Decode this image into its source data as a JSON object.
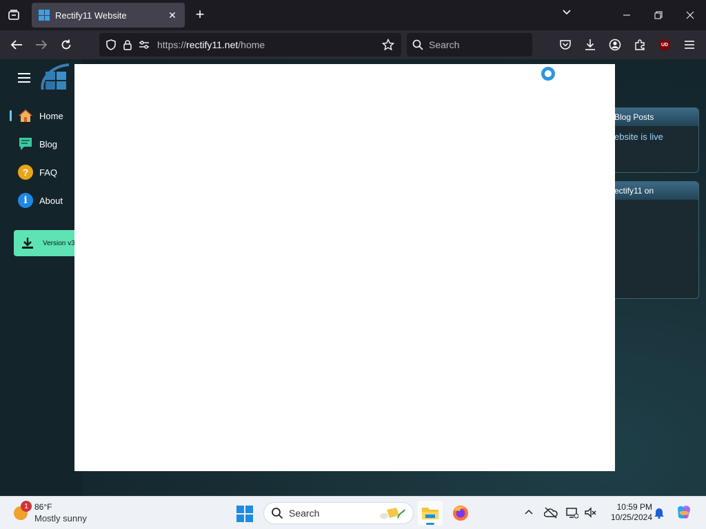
{
  "browser": {
    "tab_title": "Rectify11 Website",
    "url_prefix": "https://",
    "url_host": "rectify11.net",
    "url_path": "/home",
    "search_placeholder": "Search",
    "ublock_badge": "UD"
  },
  "site": {
    "menu": [
      {
        "label": "Home"
      },
      {
        "label": "Blog"
      },
      {
        "label": "FAQ"
      },
      {
        "label": "About"
      }
    ],
    "version_button": "Version v3",
    "cards": [
      {
        "title": "Blog Posts",
        "body": "ebsite is live"
      },
      {
        "title": "ectify11 on",
        "body": ""
      }
    ]
  },
  "taskbar": {
    "weather_temp": "86°F",
    "weather_condition": "Mostly sunny",
    "weather_badge": "1",
    "search_label": "Search",
    "time": "10:59 PM",
    "date": "10/25/2024"
  },
  "colors": {
    "accent": "#60cdff",
    "spinner": "#2e96e0",
    "version_button": "#5ee3b4"
  }
}
